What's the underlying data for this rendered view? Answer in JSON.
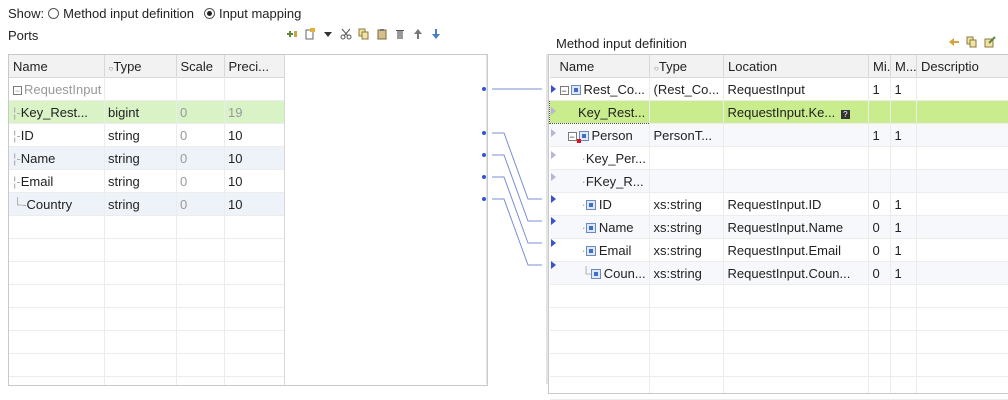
{
  "show": {
    "label": "Show:",
    "option1": "Method input definition",
    "option2": "Input mapping"
  },
  "ports": {
    "title": "Ports",
    "columns": [
      "Name",
      "Type",
      "Scale",
      "Preci..."
    ],
    "group": "RequestInput",
    "rows": [
      {
        "name": "Key_Rest...",
        "type": "bigint",
        "scale": "0",
        "precision": "19"
      },
      {
        "name": "ID",
        "type": "string",
        "scale": "0",
        "precision": "10"
      },
      {
        "name": "Name",
        "type": "string",
        "scale": "0",
        "precision": "10"
      },
      {
        "name": "Email",
        "type": "string",
        "scale": "0",
        "precision": "10"
      },
      {
        "name": "Country",
        "type": "string",
        "scale": "0",
        "precision": "10"
      }
    ]
  },
  "method": {
    "title": "Method input definition",
    "columns": [
      "Name",
      "Type",
      "Location",
      "Mi...",
      "M...",
      "Descriptio"
    ],
    "rows": [
      {
        "name": "Rest_Co...",
        "type": "(Rest_Co...",
        "location": "RequestInput",
        "min": "1",
        "max": "1"
      },
      {
        "name": "Key_Rest...",
        "type": "",
        "location": "RequestInput.Ke...",
        "min": "",
        "max": ""
      },
      {
        "name": "Person",
        "type": "PersonT...",
        "location": "",
        "min": "1",
        "max": "1"
      },
      {
        "name": "Key_Per...",
        "type": "",
        "location": "",
        "min": "",
        "max": ""
      },
      {
        "name": "FKey_R...",
        "type": "",
        "location": "",
        "min": "",
        "max": ""
      },
      {
        "name": "ID",
        "type": "xs:string",
        "location": "RequestInput.ID",
        "min": "0",
        "max": "1"
      },
      {
        "name": "Name",
        "type": "xs:string",
        "location": "RequestInput.Name",
        "min": "0",
        "max": "1"
      },
      {
        "name": "Email",
        "type": "xs:string",
        "location": "RequestInput.Email",
        "min": "0",
        "max": "1"
      },
      {
        "name": "Coun...",
        "type": "xs:string",
        "location": "RequestInput.Coun...",
        "min": "0",
        "max": "1"
      }
    ]
  }
}
